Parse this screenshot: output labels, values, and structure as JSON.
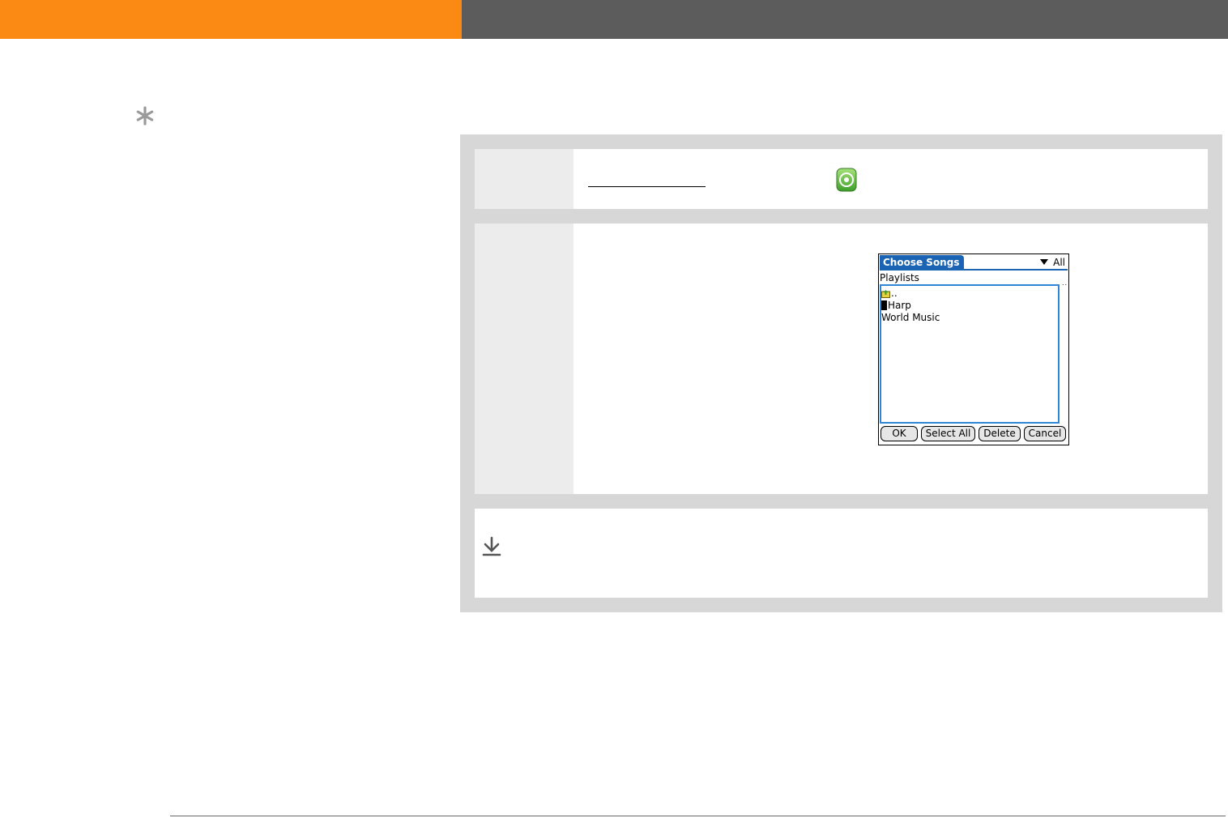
{
  "header": {
    "accent_color": "#fb8a14",
    "bar_color": "#5c5c5c"
  },
  "sidebar": {
    "tip_icon": "asterisk-icon"
  },
  "steps": [
    {
      "icon": "music-app-icon"
    },
    {
      "screen": {
        "title": "Choose Songs",
        "category": "All",
        "heading": "Playlists",
        "items": [
          {
            "icon": "folder-up-icon",
            "label": ".."
          },
          {
            "icon": "playlist-icon",
            "label": "Harp"
          },
          {
            "icon": "",
            "label": "World Music"
          }
        ],
        "scroll_indicator": "..",
        "buttons": {
          "ok": "OK",
          "select_all": "Select All",
          "delete": "Delete",
          "cancel": "Cancel"
        }
      }
    }
  ],
  "note": {
    "icon": "download-arrow-icon"
  }
}
